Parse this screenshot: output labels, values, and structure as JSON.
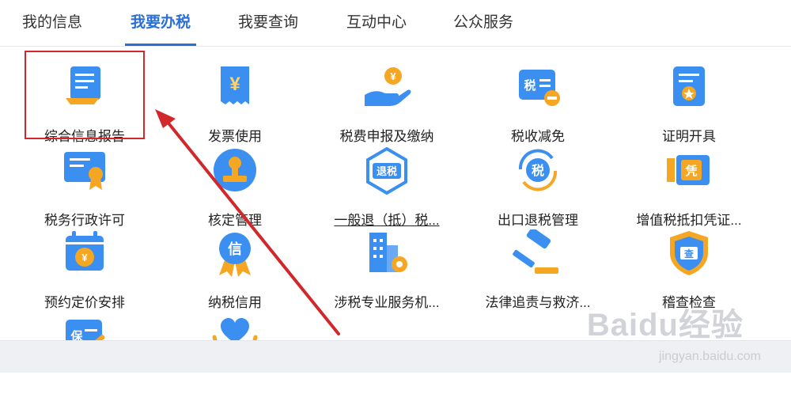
{
  "tabs": [
    {
      "label": "我的信息",
      "active": false
    },
    {
      "label": "我要办税",
      "active": true
    },
    {
      "label": "我要查询",
      "active": false
    },
    {
      "label": "互动中心",
      "active": false
    },
    {
      "label": "公众服务",
      "active": false
    }
  ],
  "services": [
    {
      "label": "综合信息报告",
      "icon": "document-report-icon",
      "highlighted": true
    },
    {
      "label": "发票使用",
      "icon": "invoice-yuan-icon"
    },
    {
      "label": "税费申报及缴纳",
      "icon": "hand-coin-icon"
    },
    {
      "label": "税收减免",
      "icon": "tax-reduction-icon",
      "icon_text": "税"
    },
    {
      "label": "证明开具",
      "icon": "certificate-icon"
    },
    {
      "label": "税务行政许可",
      "icon": "license-award-icon"
    },
    {
      "label": "核定管理",
      "icon": "stamp-icon"
    },
    {
      "label": "一般退（抵）税...",
      "icon": "tax-refund-icon",
      "icon_text": "退税"
    },
    {
      "label": "出口退税管理",
      "icon": "export-refund-icon",
      "icon_text": "税"
    },
    {
      "label": "增值税抵扣凭证...",
      "icon": "voucher-ticket-icon",
      "icon_text": "凭"
    },
    {
      "label": "预约定价安排",
      "icon": "calendar-yuan-icon"
    },
    {
      "label": "纳税信用",
      "icon": "credit-medal-icon",
      "icon_text": "信"
    },
    {
      "label": "涉税专业服务机...",
      "icon": "building-gear-icon"
    },
    {
      "label": "法律追责与救济...",
      "icon": "gavel-icon"
    },
    {
      "label": "稽查检查",
      "icon": "inspection-shield-icon",
      "icon_text": "查"
    },
    {
      "label": "",
      "icon": "guarantee-icon",
      "icon_text": "保"
    },
    {
      "label": "",
      "icon": "heart-hands-icon"
    }
  ],
  "watermark": {
    "brand": "Baidu经验",
    "url": "jingyan.baidu.com"
  },
  "colors": {
    "accent": "#2a6fd6",
    "annotation": "#d2282b",
    "icon_blue": "#3b8ff0",
    "icon_orange": "#f5a623"
  }
}
